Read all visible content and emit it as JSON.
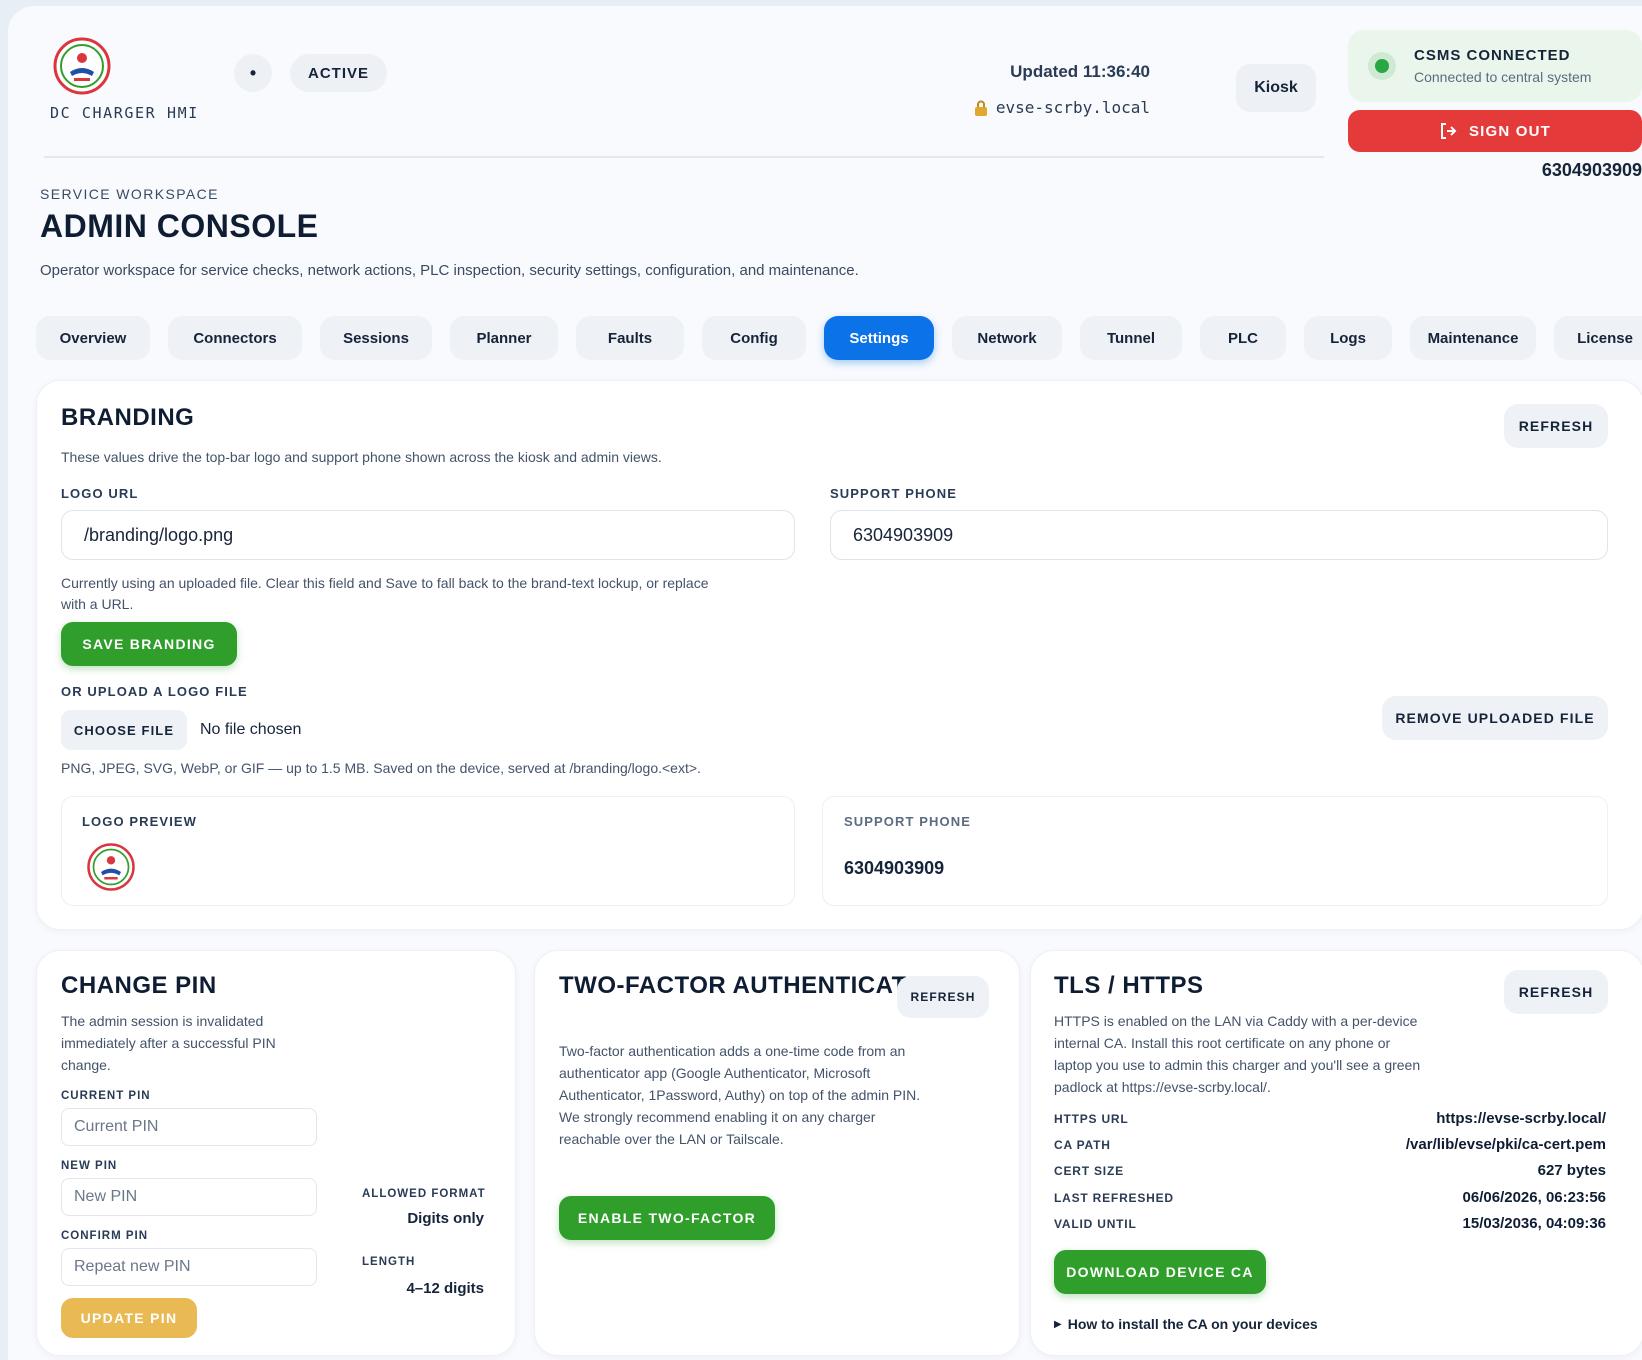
{
  "topbar": {
    "brand_text": "DC CHARGER HMI",
    "status_dot": "•",
    "status_label": "ACTIVE",
    "updated": "Updated 11:36:40",
    "host": "evse-scrby.local",
    "kiosk_label": "Kiosk",
    "csms_title": "CSMS CONNECTED",
    "csms_subtitle": "Connected to central system",
    "signout_label": "SIGN OUT",
    "support_phone": "6304903909",
    "colors": {
      "csms_dot": "#28a745",
      "signout": "#e53a3a"
    }
  },
  "header": {
    "eyebrow": "SERVICE WORKSPACE",
    "title": "ADMIN CONSOLE",
    "description": "Operator workspace for service checks, network actions, PLC inspection, security settings, configuration, and maintenance."
  },
  "tabs": [
    {
      "label": "Overview"
    },
    {
      "label": "Connectors"
    },
    {
      "label": "Sessions"
    },
    {
      "label": "Planner"
    },
    {
      "label": "Faults"
    },
    {
      "label": "Config"
    },
    {
      "label": "Settings",
      "active": true
    },
    {
      "label": "Network"
    },
    {
      "label": "Tunnel"
    },
    {
      "label": "PLC"
    },
    {
      "label": "Logs"
    },
    {
      "label": "Maintenance"
    },
    {
      "label": "License"
    }
  ],
  "branding": {
    "title": "BRANDING",
    "refresh_label": "REFRESH",
    "description": "These values drive the top-bar logo and support phone shown across the kiosk and admin views.",
    "logo_url_label": "LOGO URL",
    "logo_url_value": "/branding/logo.png",
    "support_phone_label": "SUPPORT PHONE",
    "support_phone_value": "6304903909",
    "hint_line1": "Currently using an uploaded file. Clear this field and Save to fall back to the brand-text lockup, or replace",
    "hint_line2": "with a URL.",
    "save_label": "SAVE BRANDING",
    "upload_label": "OR UPLOAD A LOGO FILE",
    "choose_file_label": "CHOOSE FILE",
    "no_file": "No file chosen",
    "remove_label": "REMOVE UPLOADED FILE",
    "formats": "PNG, JPEG, SVG, WebP, or GIF — up to 1.5 MB. Saved on the device, served at /branding/logo.<ext>.",
    "preview_label": "LOGO PREVIEW",
    "preview_phone_label": "SUPPORT PHONE",
    "preview_phone_value": "6304903909"
  },
  "change_pin": {
    "title": "CHANGE PIN",
    "description_lines": [
      "The admin session is invalidated",
      "immediately after a successful PIN",
      "change."
    ],
    "current_label": "CURRENT PIN",
    "current_placeholder": "Current PIN",
    "new_label": "NEW PIN",
    "new_placeholder": "New PIN",
    "confirm_label": "CONFIRM PIN",
    "confirm_placeholder": "Repeat new PIN",
    "format_label": "ALLOWED FORMAT",
    "format_value": "Digits only",
    "length_label": "LENGTH",
    "length_value": "4–12 digits",
    "update_label": "UPDATE PIN"
  },
  "two_factor": {
    "title": "TWO-FACTOR AUTHENTICATION",
    "refresh_label": "REFRESH",
    "description_lines": [
      "Two-factor authentication adds a one-time code from an",
      "authenticator app (Google Authenticator, Microsoft",
      "Authenticator, 1Password, Authy) on top of the admin PIN.",
      "We strongly recommend enabling it on any charger",
      "reachable over the LAN or Tailscale."
    ],
    "enable_label": "ENABLE TWO-FACTOR"
  },
  "tls": {
    "title": "TLS / HTTPS",
    "refresh_label": "REFRESH",
    "description_lines": [
      "HTTPS is enabled on the LAN via Caddy with a per-device",
      "internal CA. Install this root certificate on any phone or",
      "laptop you use to admin this charger and you'll see a green",
      "padlock at https://evse-scrby.local/."
    ],
    "rows": [
      {
        "key": "HTTPS URL",
        "value": "https://evse-scrby.local/"
      },
      {
        "key": "CA PATH",
        "value": "/var/lib/evse/pki/ca-cert.pem"
      },
      {
        "key": "CERT SIZE",
        "value": "627 bytes"
      },
      {
        "key": "LAST REFRESHED",
        "value": "06/06/2026, 06:23:56"
      },
      {
        "key": "VALID UNTIL",
        "value": "15/03/2036, 04:09:36"
      }
    ],
    "download_label": "DOWNLOAD DEVICE CA",
    "howto_label": "How to install the CA on your devices"
  }
}
